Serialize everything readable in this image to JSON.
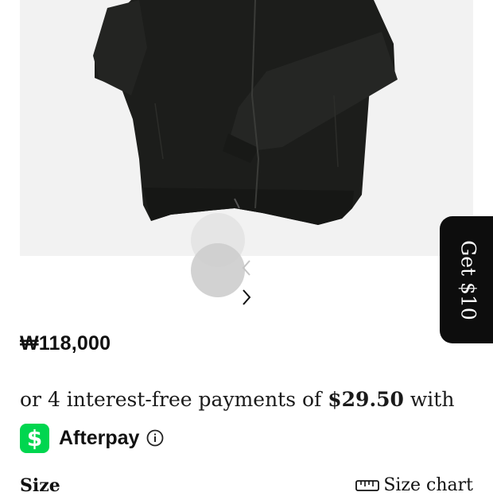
{
  "product": {
    "image_alt": "black zip-up jacket",
    "price": "₩118,000"
  },
  "payment": {
    "installment_prefix": "or 4 interest-free payments of",
    "installment_amount": "$29.50",
    "installment_suffix": "with",
    "provider_logo_symbol": "$",
    "provider_label": "Afterpay",
    "accent_color": "#00d64f"
  },
  "size": {
    "label": "Size",
    "chart_label": "Size chart"
  },
  "promo": {
    "label": "Get $10"
  },
  "icons": {
    "prev": "chevron-left-icon",
    "next": "chevron-right-icon",
    "info": "info-icon",
    "ruler": "ruler-icon"
  }
}
